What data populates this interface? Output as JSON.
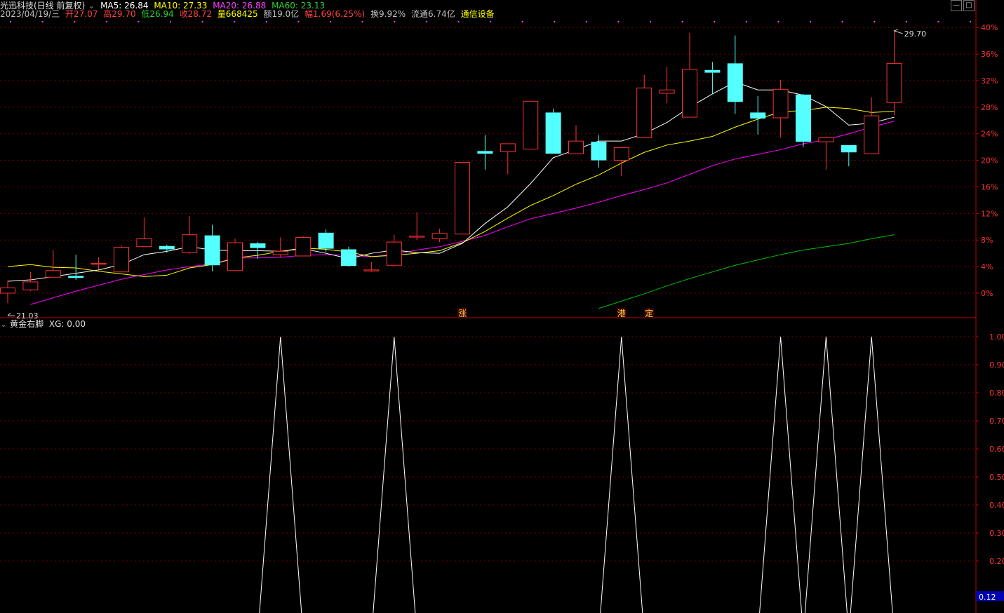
{
  "header": {
    "title": "光迅科技(日线 前复权)",
    "ma5": "MA5: 26.84",
    "ma10": "MA10: 27.33",
    "ma20": "MA20: 26.88",
    "ma60": "MA60: 23.13",
    "date": "2023/04/19/三",
    "open": "开27.07",
    "high": "高29.70",
    "low": "低26.94",
    "close": "收28.72",
    "volume": "量668425",
    "amount": "额19.0亿",
    "change": "幅1.69(6.25%)",
    "turnover": "换9.92%",
    "float": "流通6.74亿",
    "industry": "通信设备"
  },
  "indicator_header": {
    "name": "黄金右脚",
    "value": "XG: 0.00"
  },
  "window_buttons": {
    "minimize": "—",
    "maximize": "□"
  },
  "colors": {
    "up": "#ff3232",
    "down": "#54ffff",
    "ma5": "#ffffff",
    "ma10": "#ffff00",
    "ma20": "#ff00ff",
    "ma60": "#00c000",
    "axis": "#c00000",
    "grid": "#7a0000"
  },
  "chart_data": [
    {
      "type": "candlestick",
      "title": "光迅科技(日线 前复权)",
      "y_axis_labels": [
        "40%",
        "36%",
        "32%",
        "28%",
        "24%",
        "20%",
        "16%",
        "12%",
        "8%",
        "4%",
        "0%"
      ],
      "y_axis_pct": [
        40,
        36,
        32,
        28,
        24,
        20,
        16,
        12,
        8,
        4,
        0
      ],
      "base_price": 21.03,
      "low_marker": "21.03",
      "high_marker": "29.70",
      "candles": [
        {
          "o": 0.0,
          "c": 0.8,
          "h": 1.9,
          "l": -1.5
        },
        {
          "o": 0.5,
          "c": 1.7,
          "h": 3.2,
          "l": 0.3
        },
        {
          "o": 2.4,
          "c": 3.4,
          "h": 6.5,
          "l": 2.4
        },
        {
          "o": 2.6,
          "c": 2.3,
          "h": 5.8,
          "l": 2.0
        },
        {
          "o": 4.5,
          "c": 4.5,
          "h": 5.4,
          "l": 3.6
        },
        {
          "o": 3.2,
          "c": 6.9,
          "h": 7.2,
          "l": 3.2
        },
        {
          "o": 7.0,
          "c": 8.2,
          "h": 11.4,
          "l": 7.0
        },
        {
          "o": 7.1,
          "c": 6.6,
          "h": 7.3,
          "l": 6.1
        },
        {
          "o": 6.1,
          "c": 8.8,
          "h": 11.6,
          "l": 5.9
        },
        {
          "o": 8.7,
          "c": 4.2,
          "h": 10.3,
          "l": 3.3
        },
        {
          "o": 3.4,
          "c": 7.6,
          "h": 8.2,
          "l": 3.4
        },
        {
          "o": 7.5,
          "c": 6.8,
          "h": 7.7,
          "l": 5.2
        },
        {
          "o": 5.8,
          "c": 6.3,
          "h": 8.4,
          "l": 5.4
        },
        {
          "o": 5.6,
          "c": 8.4,
          "h": 8.6,
          "l": 5.6
        },
        {
          "o": 9.1,
          "c": 6.7,
          "h": 9.6,
          "l": 6.2
        },
        {
          "o": 6.6,
          "c": 4.1,
          "h": 7.0,
          "l": 4.0
        },
        {
          "o": 3.5,
          "c": 3.5,
          "h": 4.7,
          "l": 3.2
        },
        {
          "o": 4.2,
          "c": 7.7,
          "h": 8.8,
          "l": 4.0
        },
        {
          "o": 8.6,
          "c": 8.6,
          "h": 12.2,
          "l": 8.0
        },
        {
          "o": 8.2,
          "c": 9.0,
          "h": 9.7,
          "l": 7.7
        },
        {
          "o": 8.9,
          "c": 19.7,
          "h": 19.7,
          "l": 8.9
        },
        {
          "o": 21.4,
          "c": 21.0,
          "h": 23.8,
          "l": 18.6
        },
        {
          "o": 21.3,
          "c": 22.5,
          "h": 22.5,
          "l": 17.9
        },
        {
          "o": 21.7,
          "c": 28.9,
          "h": 28.9,
          "l": 21.6
        },
        {
          "o": 27.2,
          "c": 21.0,
          "h": 27.8,
          "l": 21.0
        },
        {
          "o": 21.0,
          "c": 22.9,
          "h": 25.3,
          "l": 21.0
        },
        {
          "o": 22.8,
          "c": 20.0,
          "h": 23.8,
          "l": 18.9
        },
        {
          "o": 20.0,
          "c": 21.9,
          "h": 22.0,
          "l": 17.6
        },
        {
          "o": 23.4,
          "c": 30.9,
          "h": 32.9,
          "l": 23.4
        },
        {
          "o": 30.1,
          "c": 30.6,
          "h": 34.1,
          "l": 28.6
        },
        {
          "o": 26.5,
          "c": 33.7,
          "h": 39.2,
          "l": 26.5
        },
        {
          "o": 33.6,
          "c": 33.2,
          "h": 34.8,
          "l": 30.0
        },
        {
          "o": 34.6,
          "c": 28.8,
          "h": 38.8,
          "l": 27.0
        },
        {
          "o": 27.2,
          "c": 26.3,
          "h": 29.7,
          "l": 23.9
        },
        {
          "o": 26.4,
          "c": 30.7,
          "h": 32.1,
          "l": 23.4
        },
        {
          "o": 29.9,
          "c": 22.8,
          "h": 30.0,
          "l": 22.0
        },
        {
          "o": 22.8,
          "c": 23.4,
          "h": 23.5,
          "l": 18.6
        },
        {
          "o": 22.3,
          "c": 21.2,
          "h": 22.3,
          "l": 19.1
        },
        {
          "o": 21.0,
          "c": 26.7,
          "h": 29.5,
          "l": 21.0
        },
        {
          "o": 28.7,
          "c": 34.6,
          "h": 39.5,
          "l": 26.8
        }
      ],
      "ma5": [
        1.8,
        2.0,
        2.5,
        3.0,
        3.5,
        4.3,
        5.8,
        6.3,
        7.0,
        6.5,
        6.4,
        6.4,
        6.3,
        6.7,
        6.0,
        5.2,
        6.0,
        6.5,
        6.1,
        6.0,
        7.5,
        10.5,
        13.0,
        16.5,
        20.4,
        21.6,
        22.9,
        22.9,
        24.0,
        25.7,
        28.0,
        30.0,
        31.8,
        30.6,
        30.6,
        29.8,
        28.1,
        25.3,
        25.6,
        26.5
      ],
      "ma10": [
        4.0,
        4.3,
        3.9,
        3.8,
        3.3,
        2.9,
        2.5,
        2.7,
        3.8,
        4.3,
        5.3,
        5.7,
        6.3,
        6.8,
        6.6,
        6.2,
        5.5,
        5.7,
        6.0,
        6.4,
        7.6,
        9.3,
        11.3,
        13.2,
        14.7,
        16.4,
        17.8,
        19.6,
        21.2,
        22.3,
        22.9,
        23.6,
        25.0,
        26.2,
        27.3,
        27.5,
        28.0,
        27.8,
        27.2,
        27.4
      ],
      "ma20": [
        null,
        -1.7,
        -0.7,
        0.3,
        1.2,
        2.1,
        2.8,
        3.5,
        4.0,
        4.4,
        5.3,
        5.3,
        5.4,
        5.7,
        5.8,
        5.7,
        5.5,
        5.8,
        6.5,
        7.0,
        7.8,
        8.7,
        10.0,
        11.2,
        12.0,
        12.8,
        13.7,
        14.7,
        15.6,
        16.6,
        17.9,
        19.2,
        20.2,
        20.9,
        21.6,
        22.5,
        23.1,
        24.0,
        25.0,
        25.9
      ],
      "ma60": [
        null,
        null,
        null,
        null,
        null,
        null,
        null,
        null,
        null,
        null,
        null,
        null,
        null,
        null,
        null,
        null,
        null,
        null,
        null,
        null,
        null,
        null,
        null,
        null,
        null,
        null,
        -2.3,
        -1.2,
        -0.1,
        1.1,
        2.2,
        3.2,
        4.2,
        5.0,
        5.8,
        6.5,
        7.0,
        7.5,
        8.2,
        8.8
      ],
      "markers": [
        {
          "index": 20,
          "label": "涨"
        },
        {
          "index": 27,
          "label": "港"
        },
        {
          "index": 28,
          "label": "定"
        }
      ]
    },
    {
      "type": "line",
      "title": "黄金右脚",
      "series_name": "XG",
      "y_axis_labels": [
        "1.00",
        "0.90",
        "0.80",
        "0.70",
        "0.60",
        "0.50",
        "0.40",
        "0.30",
        "0.20"
      ],
      "y_axis_values": [
        1.0,
        0.9,
        0.8,
        0.7,
        0.6,
        0.5,
        0.4,
        0.3,
        0.2
      ],
      "current_value_label": "0.12",
      "spikes_at_index": [
        12,
        17,
        27,
        34,
        36,
        38
      ]
    }
  ]
}
